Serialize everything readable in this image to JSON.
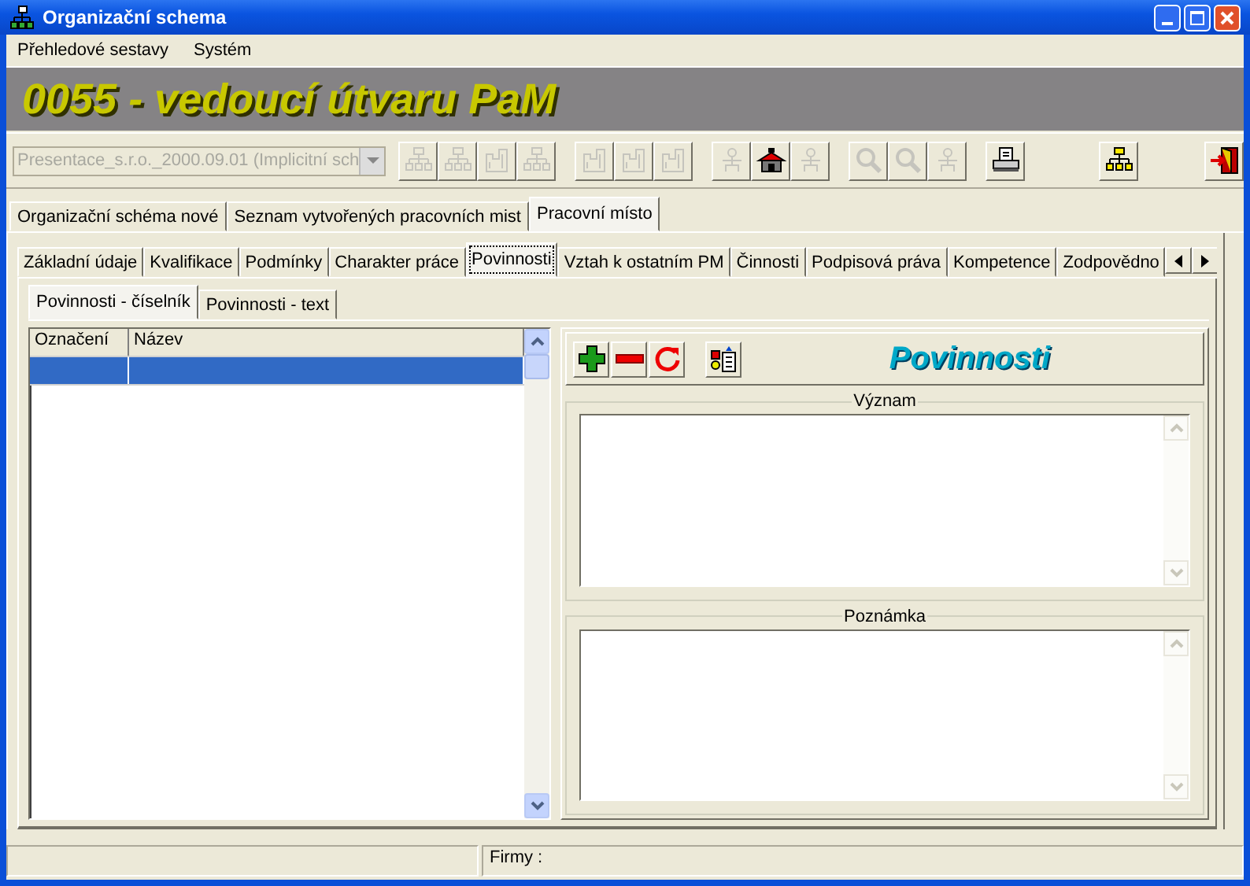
{
  "window": {
    "title": "Organizační schema"
  },
  "menu": [
    {
      "label": "Přehledové sestavy"
    },
    {
      "label": "Systém"
    }
  ],
  "banner": {
    "title": "0055 - vedoucí útvaru PaM"
  },
  "toolbar": {
    "combo": {
      "value": "Presentace_s.r.o._2000.09.01   (Implicitní sch",
      "disabled": true
    },
    "groups": [
      [
        {
          "kind": "tree",
          "disabled": true
        },
        {
          "kind": "tree",
          "disabled": true
        },
        {
          "kind": "building",
          "disabled": true
        },
        {
          "kind": "tree",
          "disabled": true
        }
      ],
      [
        {
          "kind": "building",
          "disabled": true
        },
        {
          "kind": "building",
          "disabled": true
        },
        {
          "kind": "building",
          "disabled": true
        }
      ],
      [
        {
          "kind": "person",
          "disabled": true
        },
        {
          "kind": "house",
          "disabled": false
        },
        {
          "kind": "person",
          "disabled": true
        }
      ],
      [
        {
          "kind": "search",
          "disabled": true
        },
        {
          "kind": "search",
          "disabled": true
        },
        {
          "kind": "person",
          "disabled": true
        }
      ],
      [
        {
          "kind": "printer",
          "disabled": false
        }
      ],
      [
        {
          "kind": "tree",
          "disabled": false
        }
      ],
      [
        {
          "kind": "exit",
          "disabled": false
        }
      ]
    ]
  },
  "tabs": [
    {
      "label": "Organizační schéma nové",
      "selected": false
    },
    {
      "label": "Seznam vytvořených pracovních mist",
      "selected": false
    },
    {
      "label": "Pracovní místo",
      "selected": true
    }
  ],
  "subtabs": [
    {
      "label": "Základní údaje",
      "selected": false
    },
    {
      "label": "Kvalifikace",
      "selected": false
    },
    {
      "label": "Podmínky",
      "selected": false
    },
    {
      "label": "Charakter práce",
      "selected": false
    },
    {
      "label": "Povinnosti",
      "selected": true
    },
    {
      "label": "Vztah k ostatním PM",
      "selected": false
    },
    {
      "label": "Činnosti",
      "selected": false
    },
    {
      "label": "Podpisová práva",
      "selected": false
    },
    {
      "label": "Kompetence",
      "selected": false
    },
    {
      "label": "Zodpovědno",
      "selected": false
    }
  ],
  "innertabs": [
    {
      "label": "Povinnosti - číselník",
      "selected": true
    },
    {
      "label": "Povinnosti - text",
      "selected": false
    }
  ],
  "table": {
    "columns": [
      "Označení",
      "Název"
    ],
    "rows": [
      {
        "selected": true
      }
    ]
  },
  "actions": [
    {
      "kind": "add"
    },
    {
      "kind": "remove"
    },
    {
      "kind": "refresh"
    },
    {
      "kind": "report"
    }
  ],
  "heading": "Povinnosti",
  "fields": [
    {
      "label": "Význam"
    },
    {
      "label": "Poznámka"
    }
  ],
  "status_bar": {
    "firms": "Firmy :"
  }
}
